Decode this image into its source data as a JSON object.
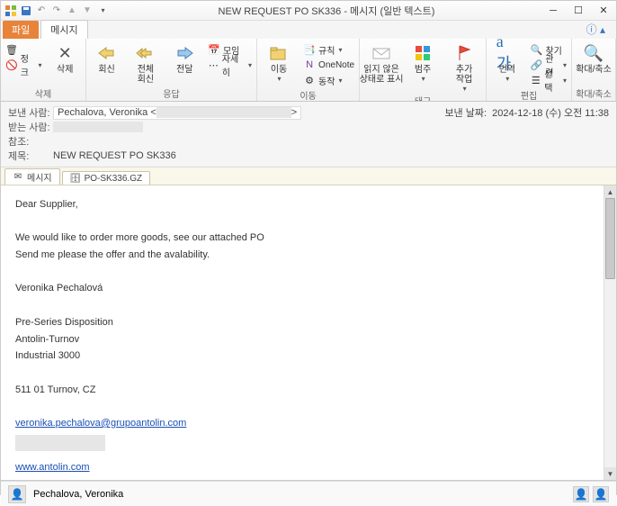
{
  "window": {
    "title": "NEW REQUEST PO SK336 - 메시지 (일반 텍스트)"
  },
  "tabs": {
    "file": "파일",
    "message": "메시지"
  },
  "ribbon": {
    "junk": "정크",
    "delete": "삭제",
    "delete_group": "삭제",
    "reply": "회신",
    "reply_all": "전체\n회신",
    "forward": "전달",
    "meeting": "모임",
    "more": "자세히",
    "respond_group": "응답",
    "move": "이동",
    "rules": "규칙",
    "onenote": "OneNote",
    "actions": "동작",
    "move_group": "이동",
    "unread": "읽지 않은\n상태로 표시",
    "categorize": "범주",
    "followup": "추가\n작업",
    "tags_group": "태그",
    "translate": "번역",
    "find": "찾기",
    "related": "관련",
    "select": "선택",
    "edit_group": "편집",
    "zoom": "확대/축소",
    "zoom_group": "확대/축소"
  },
  "header": {
    "from_lbl": "보낸 사람:",
    "from_val": "Pechalova, Veronika <",
    "to_lbl": "받는 사람:",
    "cc_lbl": "참조:",
    "subject_lbl": "제목:",
    "subject_val": "NEW REQUEST PO SK336",
    "sent_lbl": "보낸 날짜:",
    "sent_val": "2024-12-18 (수) 오전 11:38"
  },
  "attachments": {
    "tab_msg": "메시지",
    "file1": "PO-SK336.GZ"
  },
  "body": {
    "l1": "Dear Supplier,",
    "l2": "We would like to order more goods, see our attached PO",
    "l3": "Send me please the offer and the avalability.",
    "l4": "Veronika Pechalová",
    "l5": "Pre-Series Disposition",
    "l6": "Antolin-Turnov",
    "l7": "Industrial 3000",
    "l8": "511 01 Turnov, CZ",
    "email": "veronika.pechalova@grupoantolin.com",
    "site": "www.antolin.com"
  },
  "footer": {
    "name": "Pechalova, Veronika"
  }
}
